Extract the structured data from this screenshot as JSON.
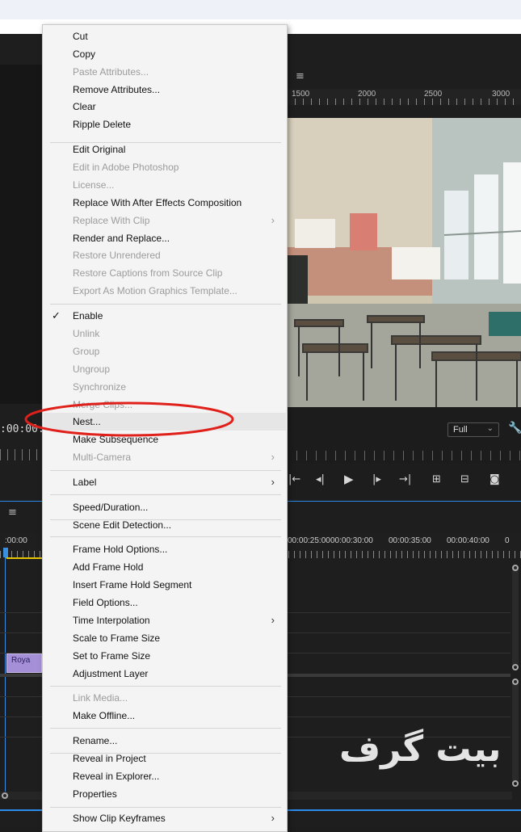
{
  "monitor": {
    "ruler_labels": [
      "1500",
      "2000",
      "2500",
      "3000"
    ],
    "left_timecode": ":00:00:0",
    "quality": "Full",
    "menu_icon": "hamburger-icon"
  },
  "transport": {
    "icons": [
      "mark-in-icon",
      "step-back-icon",
      "play-icon",
      "step-forward-icon",
      "go-to-out-icon",
      "lift-icon",
      "extract-icon",
      "camera-icon"
    ]
  },
  "timeline": {
    "timecodes": [
      ":00:00",
      "00:00:25:00",
      "00:00:30:00",
      "00:00:35:00",
      "00:00:40:00",
      "0"
    ],
    "clip_label": "Roya",
    "watermark": "بیت گرف"
  },
  "context_menu": {
    "items": [
      {
        "label": "Cut",
        "enabled": true
      },
      {
        "label": "Copy",
        "enabled": true
      },
      {
        "label": "Paste Attributes...",
        "enabled": false
      },
      {
        "label": "Remove Attributes...",
        "enabled": true
      },
      {
        "label": "Clear",
        "enabled": true
      },
      {
        "label": "Ripple Delete",
        "enabled": true
      },
      {
        "label": "Edit Original",
        "enabled": true
      },
      {
        "label": "Edit in Adobe Photoshop",
        "enabled": false
      },
      {
        "label": "License...",
        "enabled": false
      },
      {
        "label": "Replace With After Effects Composition",
        "enabled": true
      },
      {
        "label": "Replace With Clip",
        "enabled": false,
        "submenu": true
      },
      {
        "label": "Render and Replace...",
        "enabled": true
      },
      {
        "label": "Restore Unrendered",
        "enabled": false
      },
      {
        "label": "Restore Captions from Source Clip",
        "enabled": false
      },
      {
        "label": "Export As Motion Graphics Template...",
        "enabled": false
      },
      {
        "label": "Enable",
        "enabled": true,
        "checked": true
      },
      {
        "label": "Unlink",
        "enabled": false
      },
      {
        "label": "Group",
        "enabled": false
      },
      {
        "label": "Ungroup",
        "enabled": false
      },
      {
        "label": "Synchronize",
        "enabled": false
      },
      {
        "label": "Merge Clips...",
        "enabled": false
      },
      {
        "label": "Nest...",
        "enabled": true,
        "highlighted": true
      },
      {
        "label": "Make Subsequence",
        "enabled": true
      },
      {
        "label": "Multi-Camera",
        "enabled": false,
        "submenu": true
      },
      {
        "label": "Label",
        "enabled": true,
        "submenu": true
      },
      {
        "label": "Speed/Duration...",
        "enabled": true
      },
      {
        "label": "Scene Edit Detection...",
        "enabled": true
      },
      {
        "label": "Frame Hold Options...",
        "enabled": true
      },
      {
        "label": "Add Frame Hold",
        "enabled": true
      },
      {
        "label": "Insert Frame Hold Segment",
        "enabled": true
      },
      {
        "label": "Field Options...",
        "enabled": true
      },
      {
        "label": "Time Interpolation",
        "enabled": true,
        "submenu": true
      },
      {
        "label": "Scale to Frame Size",
        "enabled": true
      },
      {
        "label": "Set to Frame Size",
        "enabled": true
      },
      {
        "label": "Adjustment Layer",
        "enabled": true
      },
      {
        "label": "Link Media...",
        "enabled": false
      },
      {
        "label": "Make Offline...",
        "enabled": true
      },
      {
        "label": "Rename...",
        "enabled": true
      },
      {
        "label": "Reveal in Project",
        "enabled": true
      },
      {
        "label": "Reveal in Explorer...",
        "enabled": true
      },
      {
        "label": "Properties",
        "enabled": true
      },
      {
        "label": "Show Clip Keyframes",
        "enabled": true,
        "submenu": true
      }
    ],
    "annotation_color": "#e0201b"
  }
}
